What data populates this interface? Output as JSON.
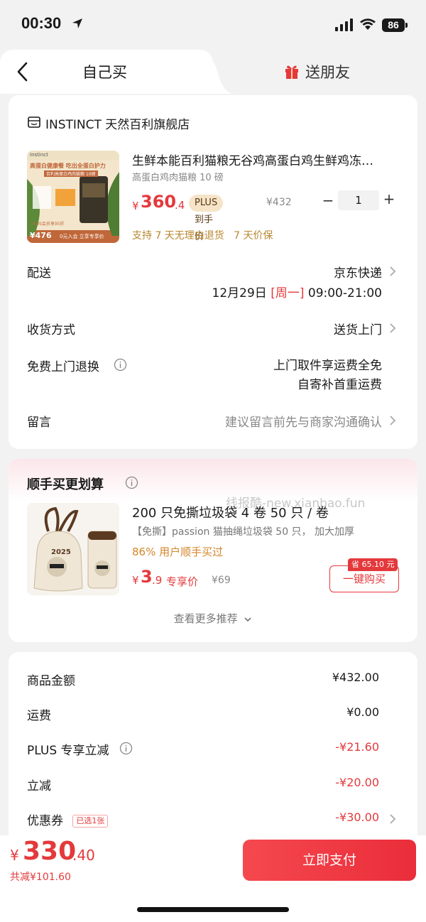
{
  "status": {
    "time": "00:30",
    "battery": "86"
  },
  "tabs": {
    "self": "自己买",
    "friend": "送朋友"
  },
  "store": {
    "name": "INSTINCT 天然百利旗舰店"
  },
  "product": {
    "title": "生鲜本能百利猫粮无谷鸡高蛋白鸡生鲜鸡冻…",
    "spec": "高蛋白鸡肉猫粮 10 磅",
    "price_symbol": "¥",
    "price_int": "360",
    "price_dec": ".4",
    "plus_label": "PLUS 到手价",
    "orig_price": "¥432",
    "qty": "1",
    "guarantee": "支持 7 天无理由退货   7 天价保",
    "img_texts": {
      "brand": "Instinct",
      "headline": "高蛋白健康餐 吃出全蛋白护力",
      "badge": "百利高蛋白鸡肉猫粮 10磅",
      "promo": "PLUS会员享95折",
      "price": "¥476",
      "cta": "0元入会 立享专享价"
    }
  },
  "delivery": {
    "label": "配送",
    "carrier": "京东快递",
    "date": "12月29日",
    "weekday": "[周一]",
    "time": "09:00-21:00"
  },
  "receive": {
    "label": "收货方式",
    "value": "送货上门"
  },
  "return": {
    "label": "免费上门退换",
    "line1": "上门取件享运费全免",
    "line2": "自寄补首重运费"
  },
  "note": {
    "label": "留言",
    "placeholder": "建议留言前先与商家沟通确认"
  },
  "addon": {
    "title": "顺手买更划算",
    "watermark": "线报酷-new.xianbao.fun",
    "name": "200 只免撕垃圾袋 4 卷 50 只 / 卷",
    "desc": "【免撕】passion 猫抽绳垃圾袋 50 只， 加大加厚",
    "stat": "86% 用户顺手买过",
    "price_symbol": "¥",
    "price_int": "3",
    "price_dec": ".9",
    "price_tag": "专享价",
    "orig_price": "¥69",
    "save_tag": "省 65.10 元",
    "buy_label": "一键购买",
    "more": "查看更多推荐",
    "img_text": "2025"
  },
  "summary": {
    "goods_label": "商品金额",
    "goods_value": "¥432.00",
    "ship_label": "运费",
    "ship_value": "¥0.00",
    "plus_label": "PLUS 专享立减",
    "plus_value": "-¥21.60",
    "cut_label": "立减",
    "cut_value": "-¥20.00",
    "coupon_label": "优惠券",
    "coupon_tag": "已选1张",
    "coupon_value": "-¥30.00"
  },
  "bottom": {
    "total_symbol": "¥",
    "total_int": "330",
    "total_dec": ".40",
    "saved": "共减¥101.60",
    "pay_label": "立即支付"
  },
  "colors": {
    "accent": "#e4393c",
    "gold": "#b8872f",
    "plus_badge": "#f6e4c8"
  }
}
